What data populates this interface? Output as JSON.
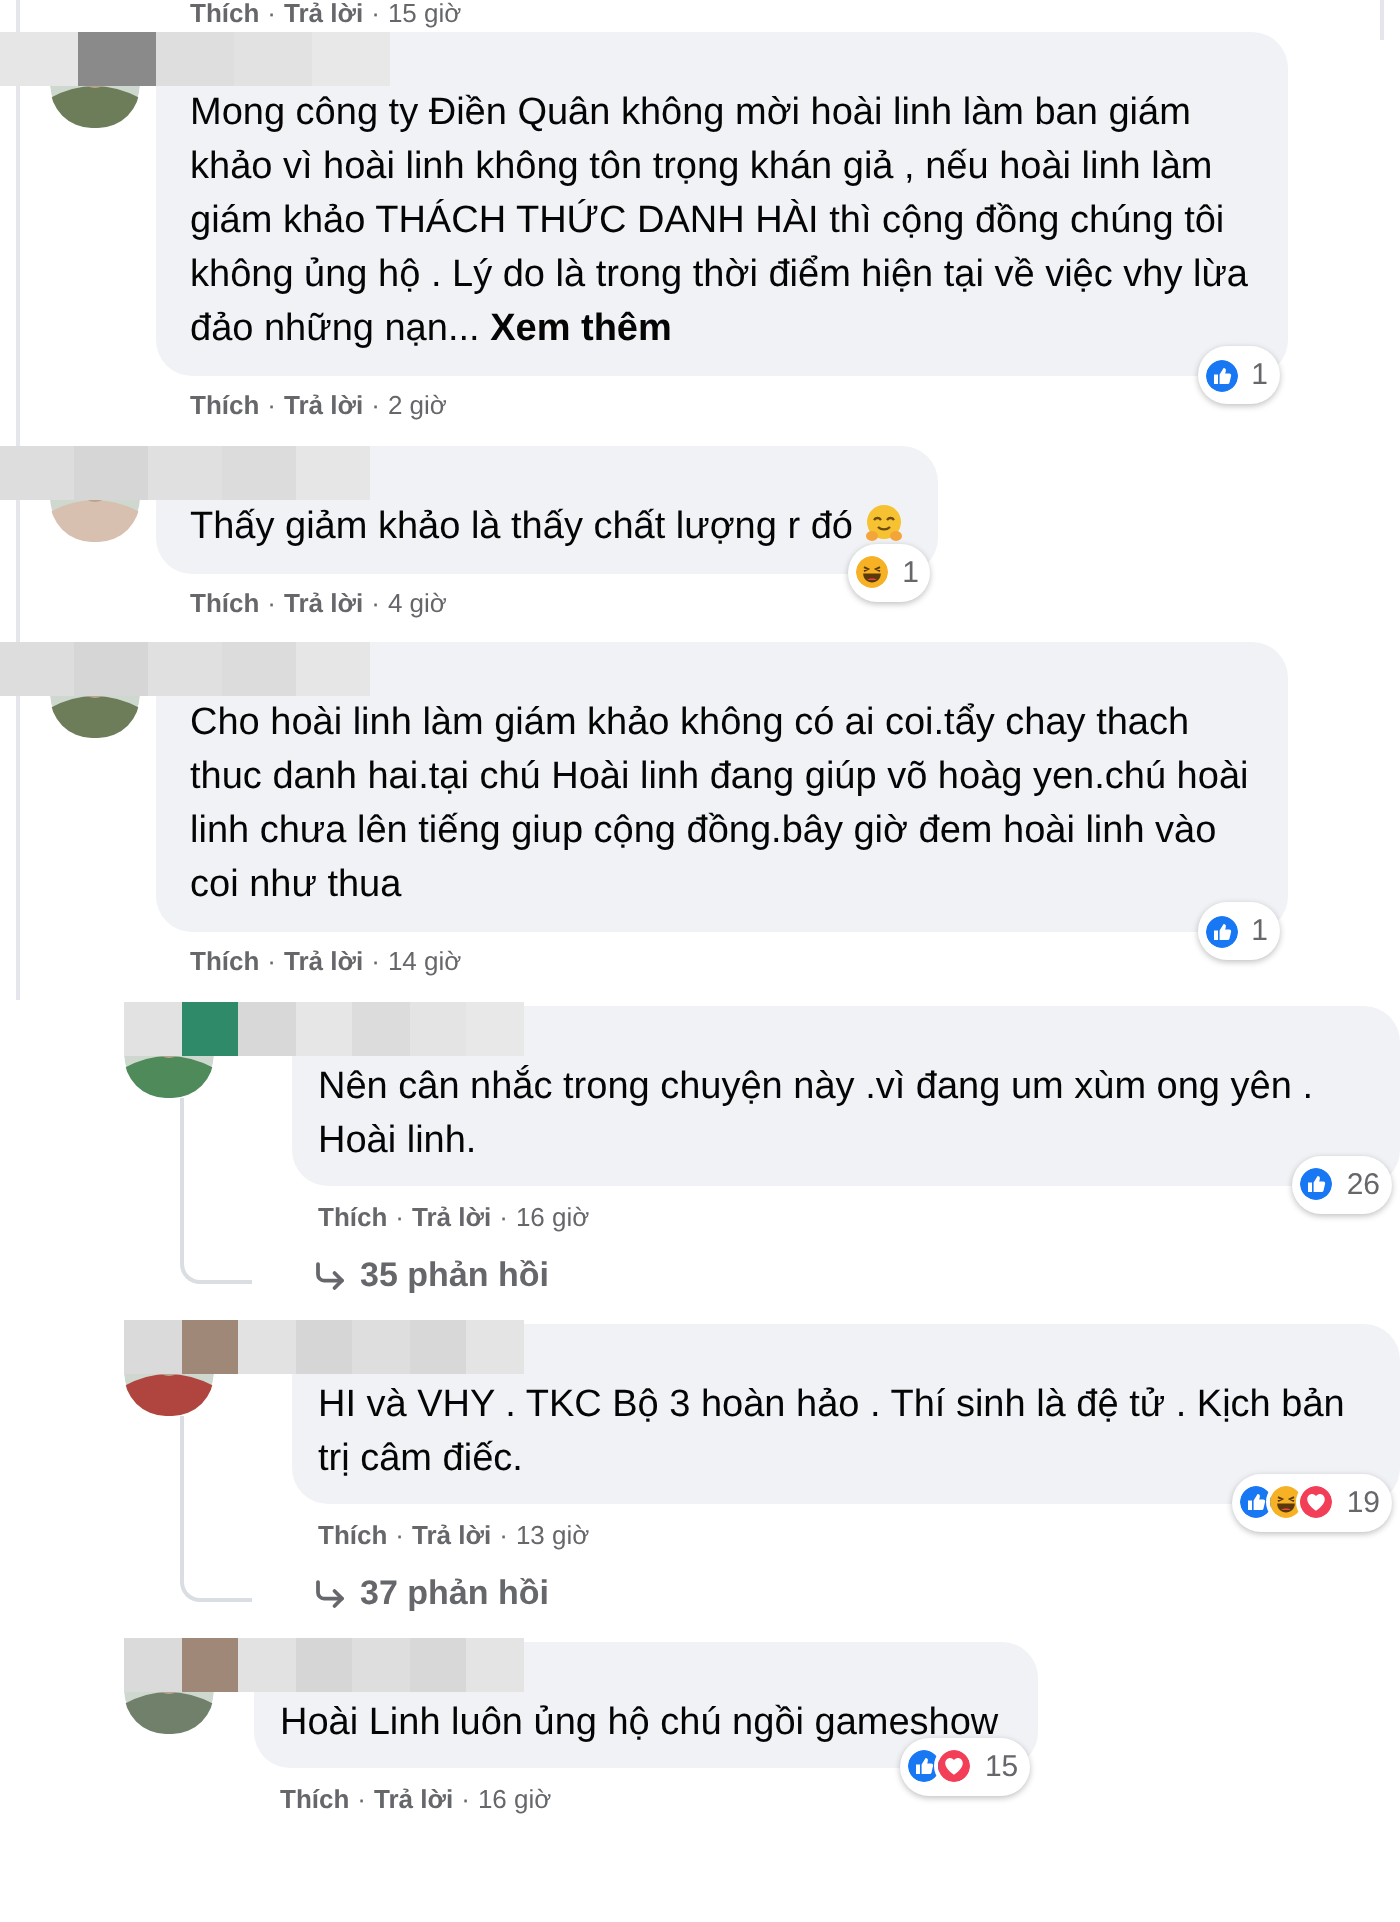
{
  "separator": "·",
  "cut_actions": {
    "like": "Thích",
    "reply": "Trả lời",
    "time": "15 giờ"
  },
  "comments": [
    {
      "text": "Mong công ty Điền Quân không mời hoài linh làm ban giám khảo vì hoài linh không tôn trọng khán giả , nếu hoài linh làm giám khảo THÁCH THỨC DANH HÀI thì cộng đồng chúng tôi không ủng hộ . Lý do là trong thời điểm hiện tại về việc vhy lừa đảo những nạn...",
      "more": "Xem thêm",
      "reactions": [
        {
          "kind": "like"
        }
      ],
      "reaction_count": "1",
      "actions": {
        "like": "Thích",
        "reply": "Trả lời",
        "time": "2 giờ"
      }
    },
    {
      "text": "Thấy giảm khảo là thấy chất lượng r đó",
      "trailing_icon": {
        "kind": "hug"
      },
      "reactions": [
        {
          "kind": "haha"
        }
      ],
      "reaction_count": "1",
      "actions": {
        "like": "Thích",
        "reply": "Trả lời",
        "time": "4 giờ"
      }
    },
    {
      "text": "Cho hoài linh làm giám khảo không có ai coi.tẩy chay thach thuc danh hai.tại chú Hoài linh đang giúp võ hoàg yen.chú hoài linh chưa lên tiếng giup cộng đồng.bây giờ đem hoài linh vào coi như thua",
      "reactions": [
        {
          "kind": "like"
        }
      ],
      "reaction_count": "1",
      "actions": {
        "like": "Thích",
        "reply": "Trả lời",
        "time": "14 giờ"
      },
      "children": [
        {
          "text": "Nên cân nhắc trong chuyện này .vì đang um xùm ong yên . Hoài linh.",
          "reactions": [
            {
              "kind": "like"
            }
          ],
          "reaction_count": "26",
          "actions": {
            "like": "Thích",
            "reply": "Trả lời",
            "time": "16 giờ"
          },
          "replies": "35 phản hồi"
        },
        {
          "text": "HI và VHY . TKC Bộ 3 hoàn hảo . Thí sinh là đệ tử . Kịch bản trị câm điếc.",
          "reactions": [
            {
              "kind": "like"
            },
            {
              "kind": "haha"
            },
            {
              "kind": "love"
            }
          ],
          "reaction_count": "19",
          "actions": {
            "like": "Thích",
            "reply": "Trả lời",
            "time": "13 giờ"
          },
          "replies": "37 phản hồi"
        },
        {
          "text": "Hoài Linh luôn ủng hộ chú ngồi gameshow",
          "reactions": [
            {
              "kind": "like"
            },
            {
              "kind": "love"
            }
          ],
          "reaction_count": "15",
          "actions": {
            "like": "Thích",
            "reply": "Trả lời",
            "time": "16 giờ"
          }
        }
      ]
    }
  ]
}
